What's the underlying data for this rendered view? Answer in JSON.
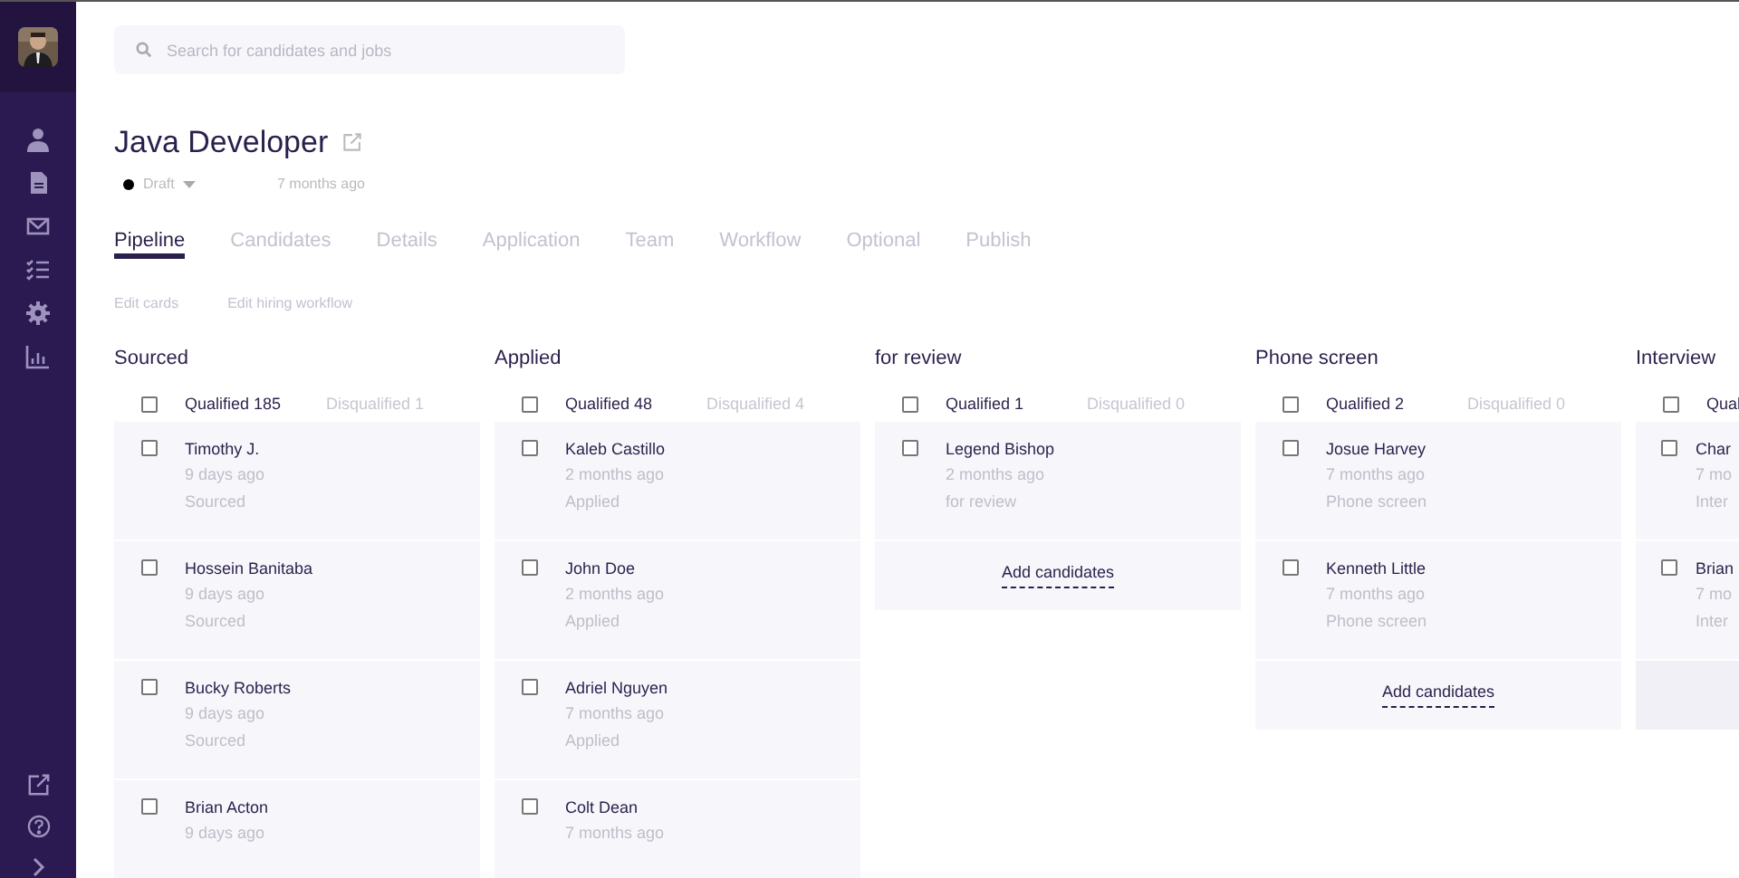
{
  "search": {
    "placeholder": "Search for candidates and jobs"
  },
  "job": {
    "title": "Java Developer",
    "status": "Draft",
    "updated": "7 months ago"
  },
  "tabs": [
    {
      "label": "Pipeline",
      "selected": true
    },
    {
      "label": "Candidates",
      "selected": false
    },
    {
      "label": "Details",
      "selected": false
    },
    {
      "label": "Application",
      "selected": false
    },
    {
      "label": "Team",
      "selected": false
    },
    {
      "label": "Workflow",
      "selected": false
    },
    {
      "label": "Optional",
      "selected": false
    },
    {
      "label": "Publish",
      "selected": false
    }
  ],
  "actions": [
    "Edit cards",
    "Edit hiring workflow"
  ],
  "stages": [
    {
      "title": "Sourced",
      "all_checked": false,
      "qualified": "Qualified",
      "qualified_count": "185",
      "disqualified": "Disqualified",
      "disqualified_count": "1",
      "cards": [
        {
          "name": "Timothy J.",
          "time": "9 days ago",
          "stage": "Sourced",
          "checked": false
        },
        {
          "name": "Hossein Banitaba",
          "time": "9 days ago",
          "stage": "Sourced",
          "checked": false
        },
        {
          "name": "Bucky Roberts",
          "time": "9 days ago",
          "stage": "Sourced",
          "checked": false
        },
        {
          "name": "Brian Acton",
          "time": "9 days ago",
          "checked": false
        }
      ]
    },
    {
      "title": "Applied",
      "all_checked": false,
      "qualified": "Qualified",
      "qualified_count": "48",
      "disqualified": "Disqualified",
      "disqualified_count": "4",
      "cards": [
        {
          "name": "Kaleb Castillo",
          "time": "2 months ago",
          "stage": "Applied",
          "checked": false
        },
        {
          "name": "John Doe",
          "time": "2 months ago",
          "stage": "Applied",
          "checked": false
        },
        {
          "name": "Adriel Nguyen",
          "time": "7 months ago",
          "stage": "Applied",
          "checked": false
        },
        {
          "name": "Colt Dean",
          "time": "7 months ago",
          "checked": false
        }
      ]
    },
    {
      "title": "for review",
      "all_checked": false,
      "qualified": "Qualified",
      "qualified_count": "1",
      "disqualified": "Disqualified",
      "disqualified_count": "0",
      "cards": [
        {
          "name": "Legend Bishop",
          "time": "2 months ago",
          "stage": "for review",
          "checked": false
        }
      ],
      "add": "Add candidates"
    },
    {
      "title": "Phone screen",
      "all_checked": false,
      "qualified": "Qualified",
      "qualified_count": "2",
      "disqualified": "Disqualified",
      "disqualified_count": "0",
      "cards": [
        {
          "name": "Josue Harvey",
          "time": "7 months ago",
          "stage": "Phone screen",
          "checked": false
        },
        {
          "name": "Kenneth Little",
          "time": "7 months ago",
          "stage": "Phone screen",
          "checked": false
        }
      ],
      "add": "Add candidates"
    },
    {
      "title": "Interview",
      "all_checked": false,
      "qualified": "Qual",
      "cards": [
        {
          "name": "Char",
          "time": "7 mo",
          "stage": "Inter",
          "checked": false
        },
        {
          "name": "Brian",
          "time": "7 mo",
          "stage": "Inter",
          "checked": false
        }
      ],
      "empty_slot": true
    }
  ]
}
